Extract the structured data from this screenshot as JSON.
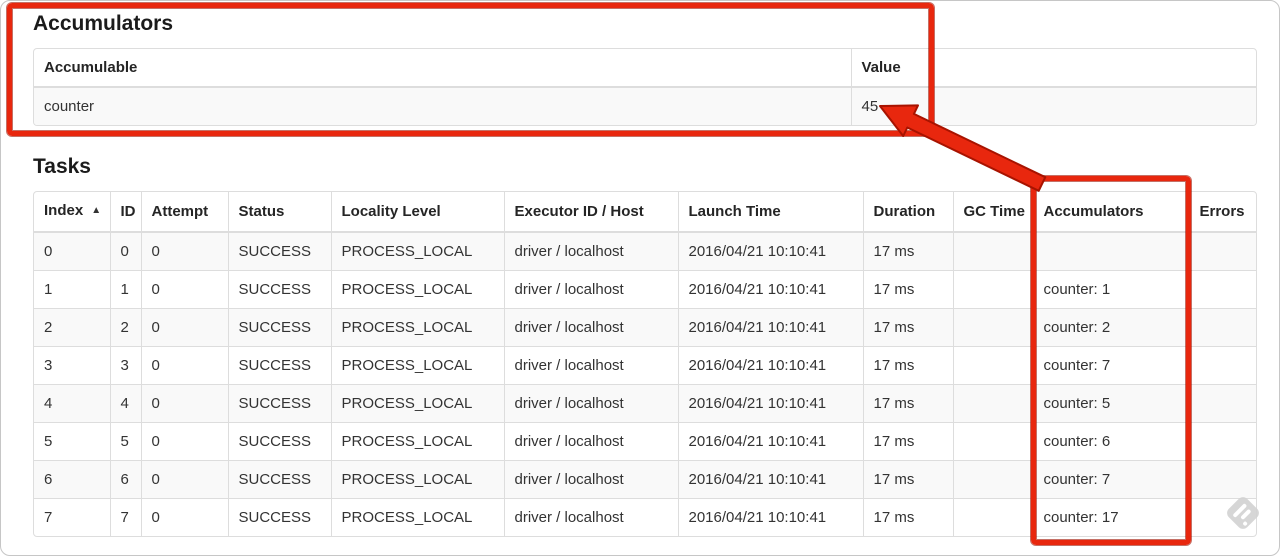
{
  "accumulators_section": {
    "heading": "Accumulators",
    "table": {
      "headers": [
        "Accumulable",
        "Value"
      ],
      "rows": [
        [
          "counter",
          "45"
        ]
      ]
    }
  },
  "tasks_section": {
    "heading": "Tasks",
    "table": {
      "headers": [
        "Index",
        "ID",
        "Attempt",
        "Status",
        "Locality Level",
        "Executor ID / Host",
        "Launch Time",
        "Duration",
        "GC Time",
        "Accumulators",
        "Errors"
      ],
      "sort_column": "Index",
      "sort_icon": "▲",
      "rows": [
        [
          "0",
          "0",
          "0",
          "SUCCESS",
          "PROCESS_LOCAL",
          "driver / localhost",
          "2016/04/21 10:10:41",
          "17 ms",
          "",
          "",
          ""
        ],
        [
          "1",
          "1",
          "0",
          "SUCCESS",
          "PROCESS_LOCAL",
          "driver / localhost",
          "2016/04/21 10:10:41",
          "17 ms",
          "",
          "counter: 1",
          ""
        ],
        [
          "2",
          "2",
          "0",
          "SUCCESS",
          "PROCESS_LOCAL",
          "driver / localhost",
          "2016/04/21 10:10:41",
          "17 ms",
          "",
          "counter: 2",
          ""
        ],
        [
          "3",
          "3",
          "0",
          "SUCCESS",
          "PROCESS_LOCAL",
          "driver / localhost",
          "2016/04/21 10:10:41",
          "17 ms",
          "",
          "counter: 7",
          ""
        ],
        [
          "4",
          "4",
          "0",
          "SUCCESS",
          "PROCESS_LOCAL",
          "driver / localhost",
          "2016/04/21 10:10:41",
          "17 ms",
          "",
          "counter: 5",
          ""
        ],
        [
          "5",
          "5",
          "0",
          "SUCCESS",
          "PROCESS_LOCAL",
          "driver / localhost",
          "2016/04/21 10:10:41",
          "17 ms",
          "",
          "counter: 6",
          ""
        ],
        [
          "6",
          "6",
          "0",
          "SUCCESS",
          "PROCESS_LOCAL",
          "driver / localhost",
          "2016/04/21 10:10:41",
          "17 ms",
          "",
          "counter: 7",
          ""
        ],
        [
          "7",
          "7",
          "0",
          "SUCCESS",
          "PROCESS_LOCAL",
          "driver / localhost",
          "2016/04/21 10:10:41",
          "17 ms",
          "",
          "counter: 17",
          ""
        ]
      ]
    }
  },
  "annotations": {
    "highlight_color": "#e8270e",
    "highlight_edge_color": "#a81300"
  }
}
